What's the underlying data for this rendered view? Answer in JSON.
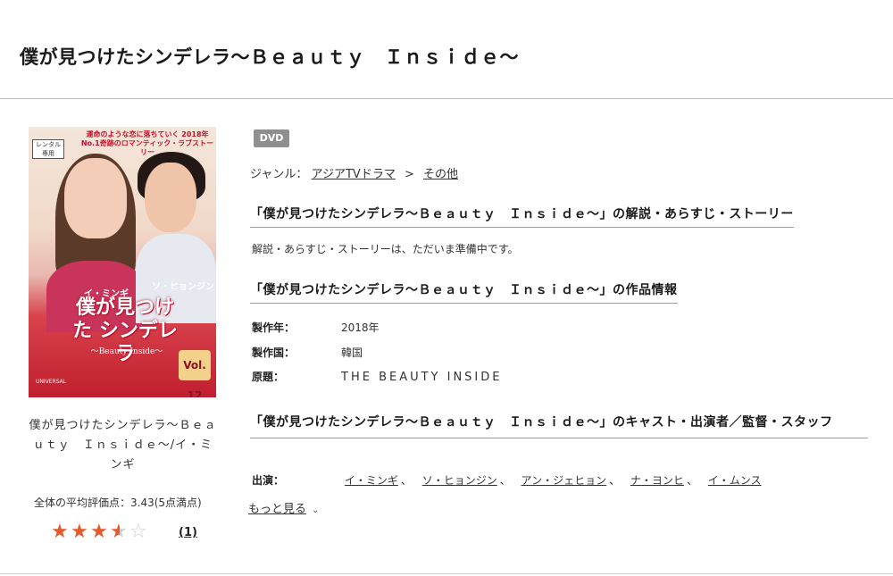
{
  "page_title": "僕が見つけたシンデレラ〜Ｂｅａｕｔｙ　Ｉｎｓｉｄｅ〜",
  "cover": {
    "badge": "レンタル 専用",
    "tagline": "運命のような恋に落ちていく 2018年No.1奇跡のロマンティック・ラブストーリー",
    "logo_main": "僕が見つけた シンデレラ",
    "logo_sub": "〜Beauty Inside〜",
    "vol": "Vol. 12",
    "brand": "UNIVERSAL",
    "cast_left": "イ・ミンギ",
    "cast_right": "ソ・ヒョンジン"
  },
  "caption": "僕が見つけたシンデレラ〜Ｂｅａｕｔｙ　Ｉｎｓｉｄｅ〜/イ・ミンギ",
  "rating": {
    "average_text": "全体の平均評価点：3.43(5点満点)",
    "value": 3.43,
    "max": 5,
    "count": "(1)"
  },
  "media_badge": "DVD",
  "genre": {
    "label": "ジャンル：",
    "items": [
      "アジアTVドラマ",
      "その他"
    ],
    "separator": ">"
  },
  "synopsis": {
    "heading": "「僕が見つけたシンデレラ〜Ｂｅａｕｔｙ　Ｉｎｓｉｄｅ〜」の解説・あらすじ・ストーリー",
    "body": "解説・あらすじ・ストーリーは、ただいま準備中です。"
  },
  "info": {
    "heading": "「僕が見つけたシンデレラ〜Ｂｅａｕｔｙ　Ｉｎｓｉｄｅ〜」の作品情報",
    "rows": [
      {
        "key": "製作年：",
        "value": "2018年"
      },
      {
        "key": "製作国：",
        "value": "韓国"
      },
      {
        "key": "原題：",
        "value": "THE BEAUTY INSIDE"
      }
    ]
  },
  "cast": {
    "heading": "「僕が見つけたシンデレラ〜Ｂｅａｕｔｙ　Ｉｎｓｉｄｅ〜」のキャスト・出演者／監督・スタッフ",
    "label": "出演：",
    "names": [
      "イ・ミンギ",
      "ソ・ヒョンジン",
      "アン・ジェヒョン",
      "ナ・ヨンヒ",
      "イ・ムンス"
    ],
    "more": "もっと見る"
  },
  "colors": {
    "star_on": "#e55a2b",
    "star_off": "#cfcfcf",
    "badge_bg": "#8f8f8f"
  }
}
